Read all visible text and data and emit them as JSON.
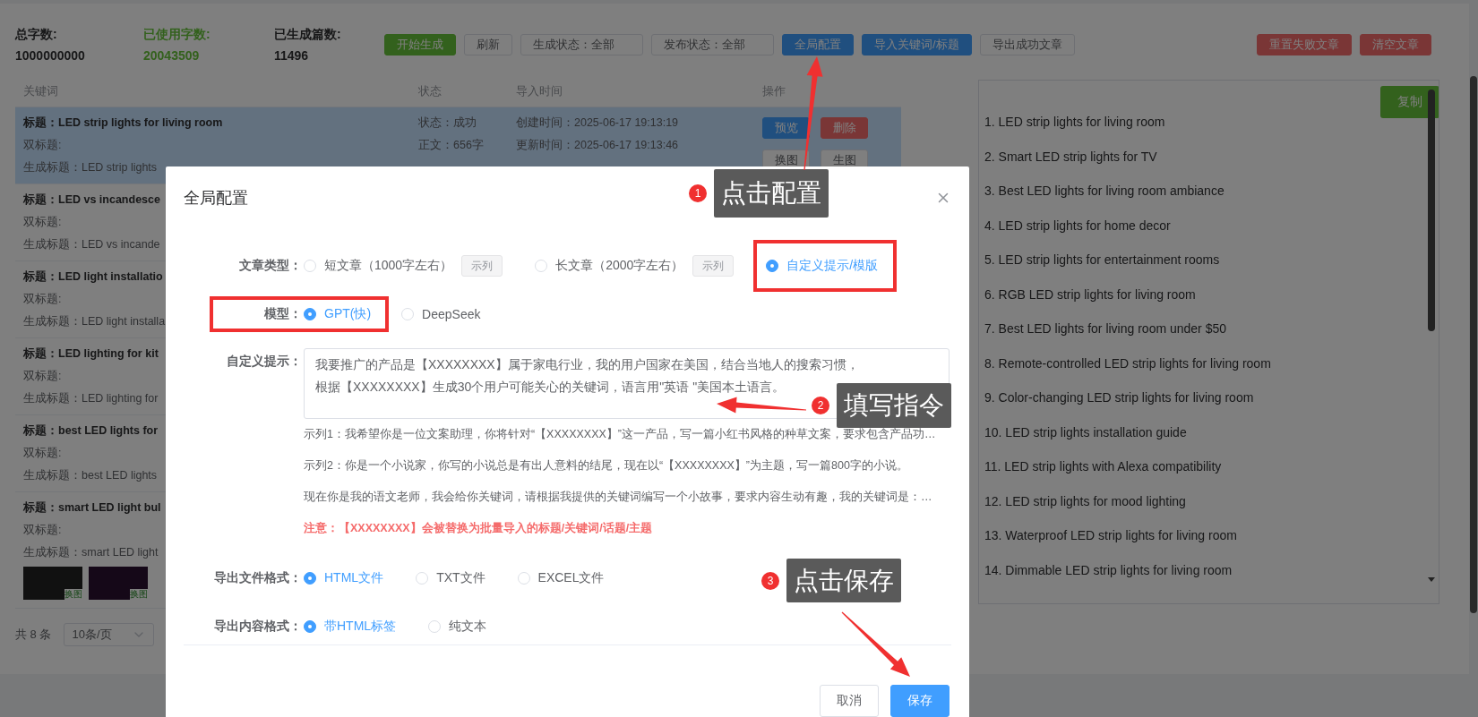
{
  "stats": [
    {
      "label": "总字数:",
      "value": "1000000000",
      "kind": "plain"
    },
    {
      "label": "已使用字数:",
      "value": "20043509",
      "kind": "success"
    },
    {
      "label": "已生成篇数:",
      "value": "11496",
      "kind": "plain"
    }
  ],
  "toolbar": [
    {
      "kind": "success",
      "label": "开始生成"
    },
    {
      "kind": "default",
      "label": "刷新"
    },
    {
      "kind": "select",
      "label": "生成状态：全部"
    },
    {
      "kind": "select",
      "label": "发布状态：全部"
    },
    {
      "kind": "primary",
      "label": "全局配置"
    },
    {
      "kind": "primary",
      "label": "导入关键词/标题"
    },
    {
      "kind": "default",
      "label": "导出成功文章"
    }
  ],
  "toolbar_right": [
    {
      "kind": "danger",
      "label": "重置失败文章"
    },
    {
      "kind": "danger",
      "label": "清空文章"
    }
  ],
  "table": {
    "columns": [
      "关键词",
      "状态",
      "导入时间",
      "操作"
    ],
    "rows": [
      {
        "selected": true,
        "title": "标题：LED strip lights for living room",
        "double_title": "双标题:",
        "generated_title": "生成标题：LED strip lights",
        "status": [
          "状态：成功",
          "正文：656字"
        ],
        "times": [
          "创建时间：2025-06-17 19:13:19",
          "更新时间：2025-06-17 19:13:46"
        ],
        "actions": [
          {
            "kind": "primary",
            "label": "预览"
          },
          {
            "kind": "danger",
            "label": "删除"
          },
          {
            "kind": "default",
            "label": "换图"
          },
          {
            "kind": "default",
            "label": "生图"
          }
        ]
      },
      {
        "selected": false,
        "title": "标题：LED vs incandesce",
        "double_title": "双标题:",
        "generated_title": "生成标题：LED vs incande"
      },
      {
        "selected": false,
        "title": "标题：LED light installatio",
        "double_title": "双标题:",
        "generated_title": "生成标题：LED light installa"
      },
      {
        "selected": false,
        "title": "标题：LED lighting for kit",
        "double_title": "双标题:",
        "generated_title": "生成标题：LED lighting for"
      },
      {
        "selected": false,
        "title": "标题：best LED lights for",
        "double_title": "双标题:",
        "generated_title": "生成标题：best LED lights"
      },
      {
        "selected": false,
        "title": "标题：smart LED light bul",
        "double_title": "双标题:",
        "generated_title": "生成标题：smart LED light",
        "images": [
          {
            "kind": "bulb",
            "caption": "换图"
          },
          {
            "kind": "ring",
            "caption": "换图"
          }
        ]
      }
    ]
  },
  "pagination": {
    "total": "共 8 条",
    "page_size": "10条/页"
  },
  "keyword_panel": {
    "copy_button": "复制",
    "items": [
      "1. LED strip lights for living room",
      "2. Smart LED strip lights for TV",
      "3. Best LED lights for living room ambiance",
      "4. LED strip lights for home decor",
      "5. LED strip lights for entertainment rooms",
      "6. RGB LED strip lights for living room",
      "7. Best LED lights for living room under $50",
      "8. Remote-controlled LED strip lights for living room",
      "9. Color-changing LED strip lights for living room",
      "10. LED strip lights installation guide",
      "11. LED strip lights with Alexa compatibility",
      "12. LED strip lights for mood lighting",
      "13. Waterproof LED strip lights for living room",
      "14. Dimmable LED strip lights for living room"
    ]
  },
  "dialog": {
    "title": "全局配置",
    "rows": [
      {
        "kind": "radio",
        "label": "文章类型：",
        "highlighted": false,
        "options": [
          {
            "label": "短文章（1000字左右）",
            "selected": false,
            "highlighted": false,
            "tag": "示列"
          },
          {
            "label": "长文章（2000字左右）",
            "selected": false,
            "highlighted": false,
            "tag": "示列"
          },
          {
            "label": "自定义提示/模版",
            "selected": true,
            "highlighted": true
          }
        ]
      },
      {
        "kind": "radio",
        "label": "模型：",
        "highlighted": true,
        "options": [
          {
            "label": "GPT(快)",
            "selected": true,
            "highlighted": false
          },
          {
            "label": "DeepSeek",
            "selected": false,
            "highlighted": false
          }
        ]
      },
      {
        "kind": "textarea",
        "label": "自定义提示：",
        "value": "我要推广的产品是【XXXXXXXX】属于家电行业，我的用户国家在美国，结合当地人的搜索习惯，根据【XXXXXXXX】生成30个用户可能关心的关键词，语言用\"英语 \"美国本土语言。",
        "examples": [
          "示列1：我希望你是一位文案助理，你将针对“【XXXXXXXX】”这一产品，写一篇小红书风格的种草文案，要求包含产品功…",
          "示列2：你是一个小说家，你写的小说总是有出人意料的结尾，现在以“【XXXXXXXX】”为主题，写一篇800字的小说。",
          "现在你是我的语文老师，我会给你关键词，请根据我提供的关键词编写一个小故事，要求内容生动有趣，我的关键词是：…"
        ],
        "note": "注意：【XXXXXXXX】会被替换为批量导入的标题/关键词/话题/主题"
      },
      {
        "kind": "radio",
        "label": "导出文件格式：",
        "highlighted": false,
        "options": [
          {
            "label": "HTML文件",
            "selected": true,
            "highlighted": false
          },
          {
            "label": "TXT文件",
            "selected": false,
            "highlighted": false
          },
          {
            "label": "EXCEL文件",
            "selected": false,
            "highlighted": false
          }
        ]
      },
      {
        "kind": "radio",
        "label": "导出内容格式：",
        "highlighted": false,
        "options": [
          {
            "label": "带HTML标签",
            "selected": true,
            "highlighted": false
          },
          {
            "label": "纯文本",
            "selected": false,
            "highlighted": false
          }
        ]
      }
    ],
    "buttons": [
      {
        "kind": "default",
        "label": "取消"
      },
      {
        "kind": "primary",
        "label": "保存"
      }
    ]
  },
  "annotations": [
    {
      "number": "1",
      "text": "点击配置"
    },
    {
      "number": "2",
      "text": "填写指令"
    },
    {
      "number": "3",
      "text": "点击保存"
    }
  ]
}
